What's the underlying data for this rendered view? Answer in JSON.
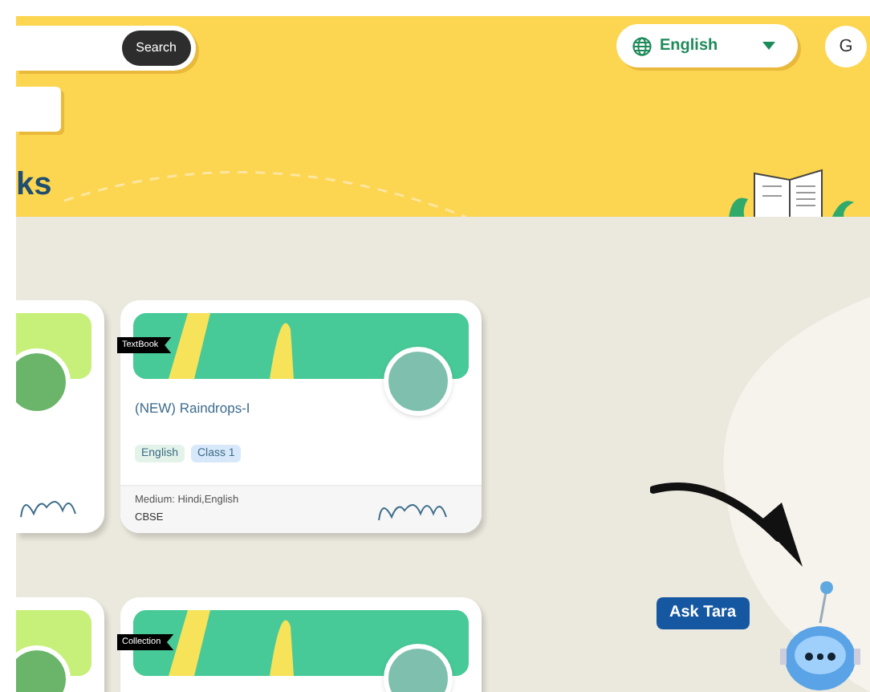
{
  "header": {
    "search": {
      "button": "Search"
    },
    "language": {
      "value": "English"
    },
    "avatar": {
      "initial": "G"
    },
    "page_title": "ks"
  },
  "rows": [
    {
      "cards": [
        {
          "kind": "partial"
        },
        {
          "kind": "textbook",
          "tag": "TextBook",
          "title": "(NEW) Raindrops-I",
          "chips": [
            {
              "label": "English",
              "kind": "subject"
            },
            {
              "label": "Class 1",
              "kind": "grade"
            }
          ],
          "medium": "Medium: Hindi,English",
          "board": "CBSE"
        }
      ]
    },
    {
      "cards": [
        {
          "kind": "partial"
        },
        {
          "kind": "collection",
          "tag": "Collection"
        }
      ]
    }
  ],
  "assistant": {
    "label": "Ask Tara"
  }
}
